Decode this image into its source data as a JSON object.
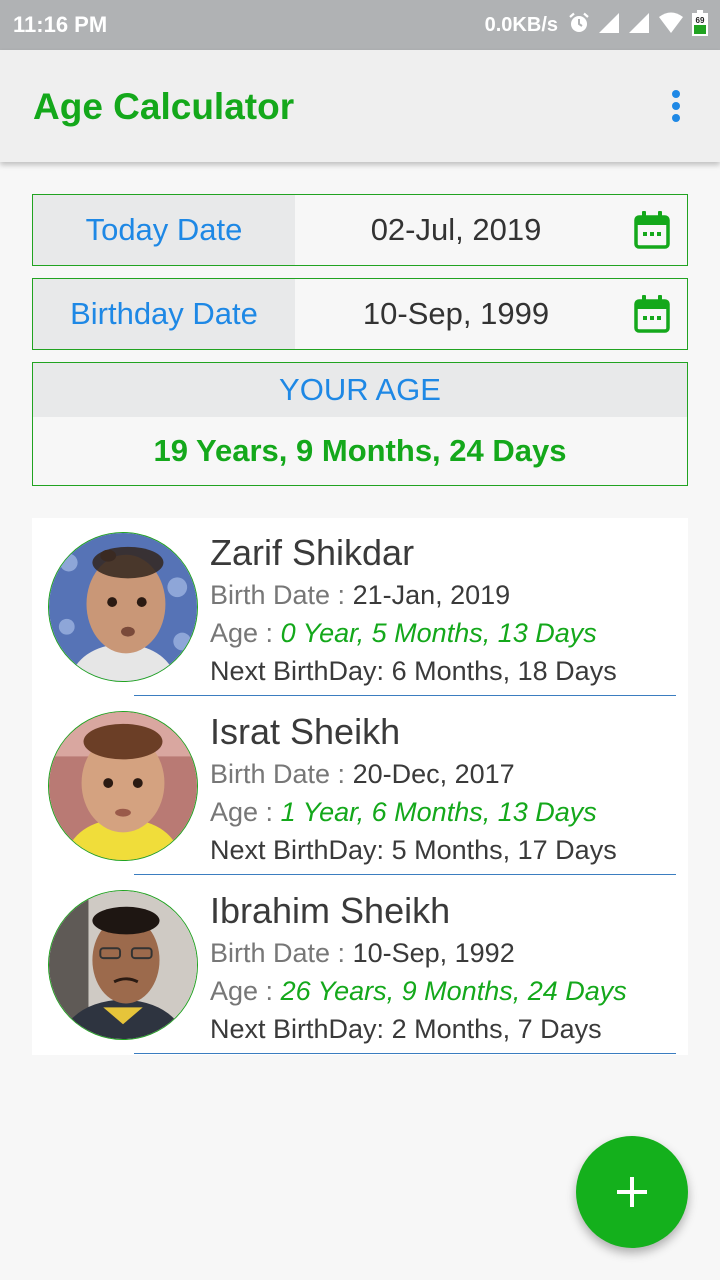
{
  "status_bar": {
    "time": "11:16 PM",
    "net_speed": "0.0KB/s",
    "icons": [
      "alarm-icon",
      "signal-icon",
      "signal-icon",
      "wifi-icon",
      "battery-icon"
    ],
    "battery_level": "69"
  },
  "app_bar": {
    "title": "Age Calculator",
    "menu_icon": "more-vert-icon"
  },
  "today": {
    "label": "Today Date",
    "value": "02-Jul, 2019",
    "icon": "calendar-icon"
  },
  "birthday": {
    "label": "Birthday Date",
    "value": "10-Sep, 1999",
    "icon": "calendar-icon"
  },
  "your_age": {
    "label": "YOUR AGE",
    "value": "19 Years, 9 Months, 24 Days"
  },
  "people": [
    {
      "name": "Zarif Shikdar",
      "birth_label": "Birth Date :",
      "birth_date": "21-Jan, 2019",
      "age_label": "Age :",
      "age": "0 Year, 5 Months, 13 Days",
      "next_label": "Next BirthDay:",
      "next": "6 Months, 18 Days"
    },
    {
      "name": "Israt Sheikh",
      "birth_label": "Birth Date :",
      "birth_date": "20-Dec, 2017",
      "age_label": "Age :",
      "age": "1 Year, 6 Months, 13 Days",
      "next_label": "Next BirthDay:",
      "next": "5 Months, 17 Days"
    },
    {
      "name": "Ibrahim Sheikh",
      "birth_label": "Birth Date :",
      "birth_date": "10-Sep, 1992",
      "age_label": "Age :",
      "age": "26 Years, 9 Months, 24 Days",
      "next_label": "Next BirthDay:",
      "next": "2 Months, 7 Days"
    }
  ],
  "fab": {
    "icon": "plus-icon"
  },
  "colors": {
    "brand_green": "#14a81b",
    "accent_blue": "#1e88e5",
    "border_green": "#21a321"
  }
}
